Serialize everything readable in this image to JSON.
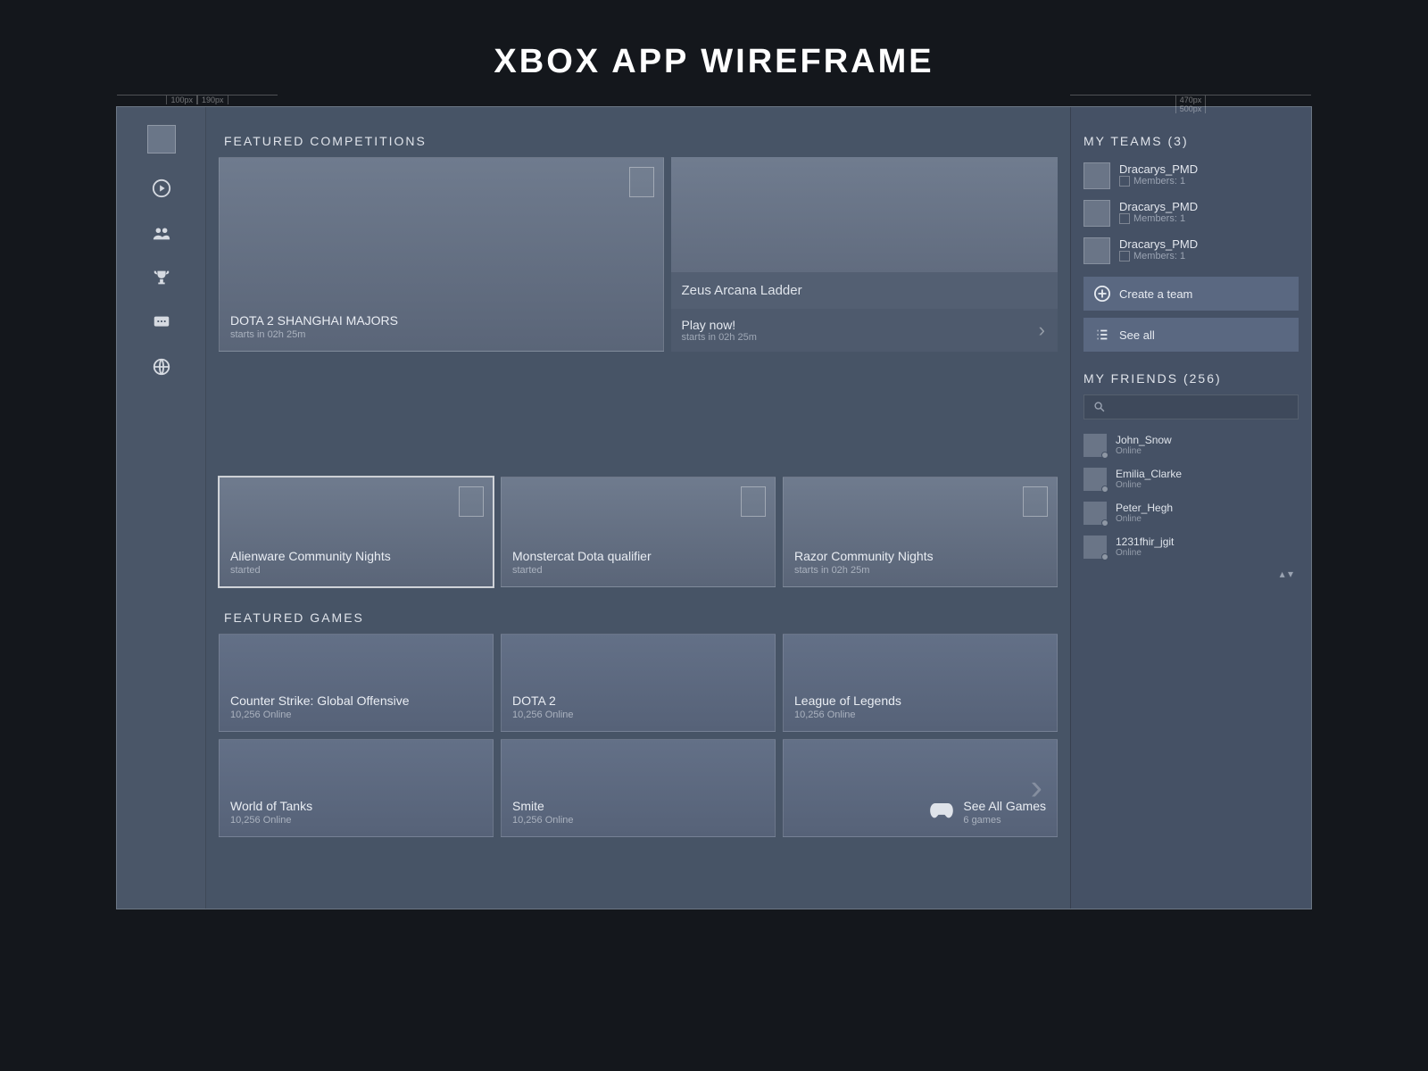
{
  "page": {
    "title": "XBOX APP WIREFRAME"
  },
  "rulers": {
    "left_a": "100px",
    "left_b": "190px",
    "right_a": "470px",
    "right_b": "500px"
  },
  "sidebar": {
    "icons": [
      "avatar",
      "play",
      "friends",
      "trophy",
      "chat",
      "globe"
    ]
  },
  "featured_competitions": {
    "header": "FEATURED COMPETITIONS",
    "hero": {
      "title": "DOTA 2 SHANGHAI MAJORS",
      "sub": "starts in 02h 25m"
    },
    "promo": {
      "title": "Zeus Arcana Ladder",
      "cta": "Play now!",
      "sub": "starts in 02h 25m"
    },
    "row": [
      {
        "title": "Alienware Community Nights",
        "sub": "started",
        "selected": true
      },
      {
        "title": "Monstercat Dota qualifier",
        "sub": "started",
        "selected": false
      },
      {
        "title": "Razor Community Nights",
        "sub": "starts in 02h 25m",
        "selected": false
      }
    ]
  },
  "featured_games": {
    "header": "FEATURED GAMES",
    "items": [
      {
        "title": "Counter Strike: Global Offensive",
        "sub": "10,256 Online"
      },
      {
        "title": "DOTA 2",
        "sub": "10,256 Online"
      },
      {
        "title": "League of Legends",
        "sub": "10,256 Online"
      },
      {
        "title": "World of Tanks",
        "sub": "10,256 Online"
      },
      {
        "title": "Smite",
        "sub": "10,256 Online"
      }
    ],
    "see_all": {
      "label": "See All Games",
      "sub": "6 games"
    }
  },
  "teams": {
    "header": "MY TEAMS (3)",
    "items": [
      {
        "name": "Dracarys_PMD",
        "meta": "Members: 1"
      },
      {
        "name": "Dracarys_PMD",
        "meta": "Members: 1"
      },
      {
        "name": "Dracarys_PMD",
        "meta": "Members: 1"
      }
    ],
    "create_label": "Create a team",
    "see_all_label": "See all"
  },
  "friends": {
    "header": "MY FRIENDS (256)",
    "search_placeholder": "",
    "items": [
      {
        "name": "John_Snow",
        "status": "Online"
      },
      {
        "name": "Emilia_Clarke",
        "status": "Online"
      },
      {
        "name": "Peter_Hegh",
        "status": "Online"
      },
      {
        "name": "1231fhir_jgit",
        "status": "Online"
      }
    ]
  }
}
